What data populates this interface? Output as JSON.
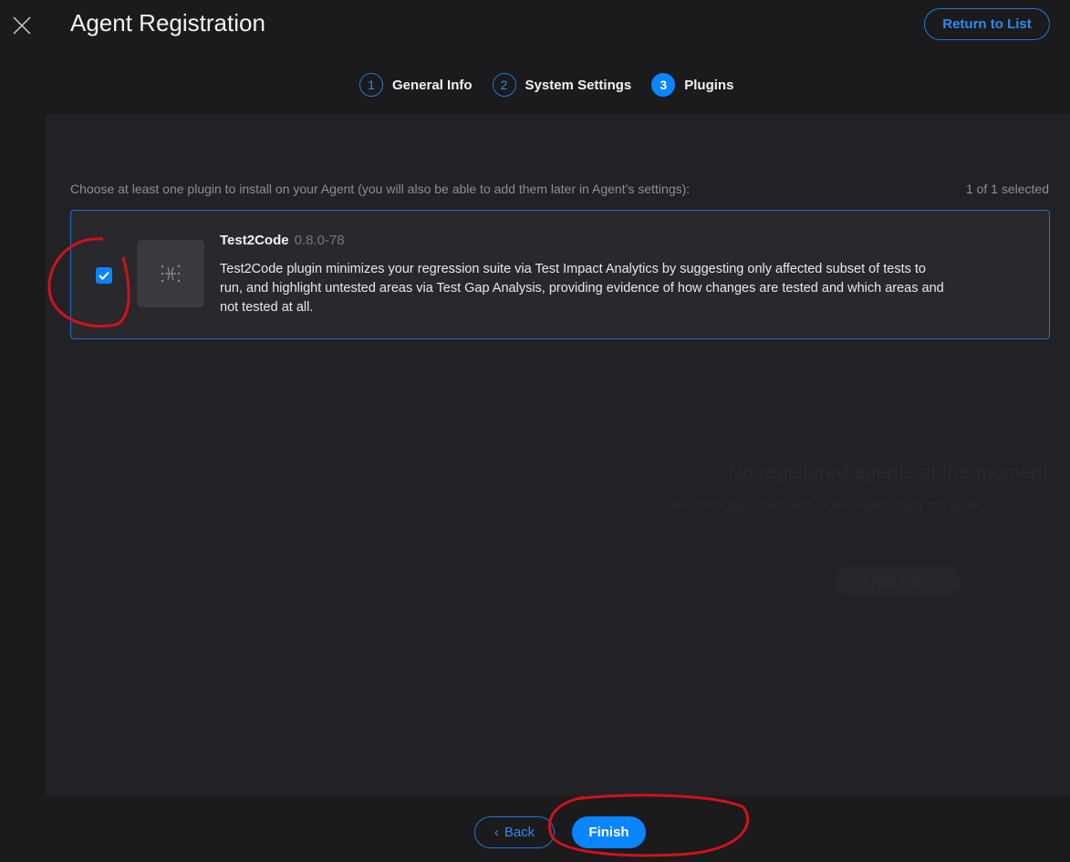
{
  "header": {
    "title": "Agent Registration",
    "return_label": "Return to List"
  },
  "steps": [
    {
      "num": "1",
      "label": "General Info"
    },
    {
      "num": "2",
      "label": "System Settings"
    },
    {
      "num": "3",
      "label": "Plugins"
    }
  ],
  "plugins": {
    "hint": "Choose at least one plugin to install on your Agent (you will also be able to add them later in Agent’s settings):",
    "count": "1 of 1 selected",
    "items": [
      {
        "name": "Test2Code",
        "version": "0.8.0-78",
        "checked": true,
        "description": "Test2Code plugin minimizes your regression suite via Test Impact Analytics by suggesting only affected subset of tests to run, and highlight untested areas via Test Gap Analysis, providing evidence of how changes are tested and which areas and not tested at all."
      }
    ]
  },
  "background": {
    "empty_title": "No registered agents at the moment",
    "empty_hint": "Run your application with Drill4J Agent using this guide",
    "add_agent": "+ Add Agent"
  },
  "footer": {
    "back_label": "Back",
    "finish_label": "Finish"
  },
  "colors": {
    "accent": "#0a84ff",
    "annotation": "#d0121b"
  }
}
